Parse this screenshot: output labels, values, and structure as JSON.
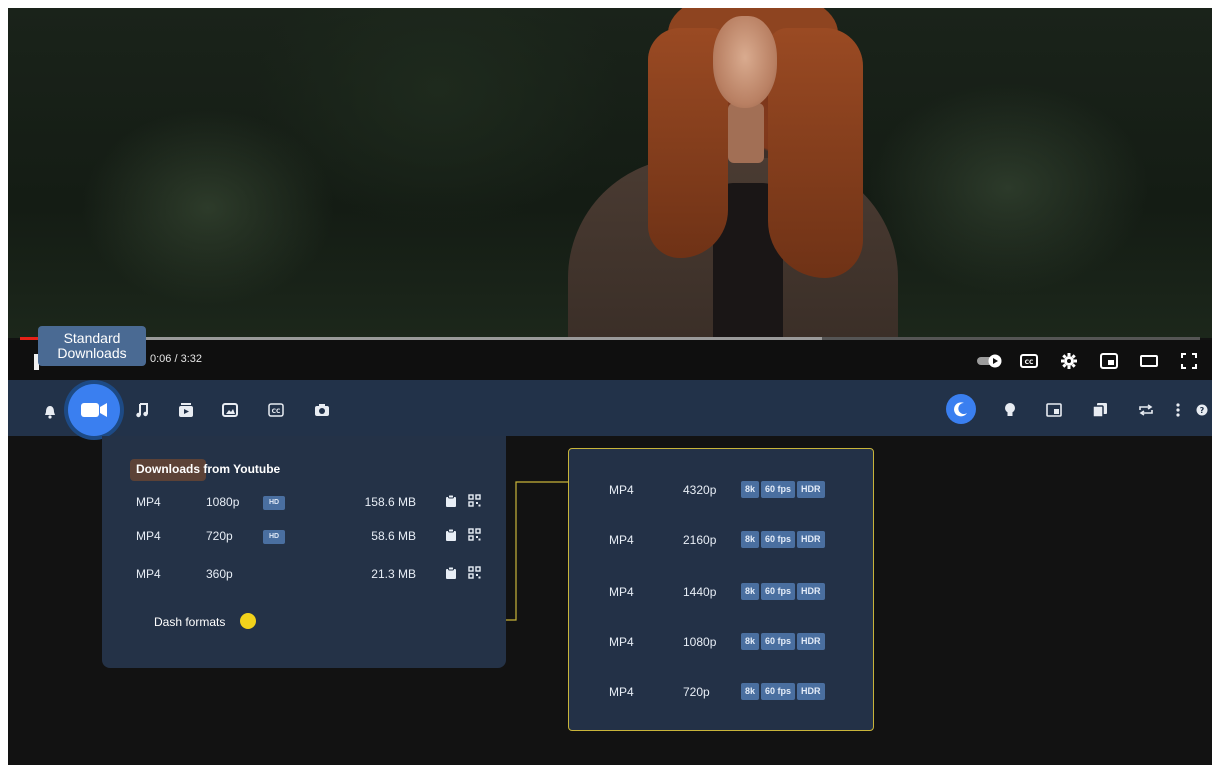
{
  "player": {
    "time": "0:06 / 3:32",
    "progress": 0.03,
    "buffered": 0.68,
    "tooltip": "Standard Downloads",
    "controls": [
      "autoplay-toggle",
      "captions",
      "settings",
      "miniplayer",
      "theater",
      "fullscreen"
    ]
  },
  "toolbar": {
    "left_icons": [
      "bell-icon",
      "video-download-icon",
      "music-icon",
      "playlist-icon",
      "image-icon",
      "subtitles-icon",
      "camera-icon"
    ],
    "right_icons": [
      "moon-icon",
      "lightbulb-icon",
      "pip-icon",
      "copy-icon",
      "repeat-icon",
      "more-icon",
      "help-icon"
    ],
    "accent": "#3a7ff0"
  },
  "downloads_panel": {
    "title": "Downloads from Youtube",
    "rows": [
      {
        "format": "MP4",
        "resolution": "1080p",
        "badge": "HD",
        "size": "158.6 MB"
      },
      {
        "format": "MP4",
        "resolution": "720p",
        "badge": "HD",
        "size": "58.6 MB"
      },
      {
        "format": "MP4",
        "resolution": "360p",
        "badge": "",
        "size": "21.3 MB"
      }
    ],
    "dash_label": "Dash formats"
  },
  "dash_panel": {
    "rows": [
      {
        "format": "MP4",
        "resolution": "4320p",
        "tags": [
          "8k",
          "60 fps",
          "HDR"
        ]
      },
      {
        "format": "MP4",
        "resolution": "2160p",
        "tags": [
          "8k",
          "60 fps",
          "HDR"
        ]
      },
      {
        "format": "MP4",
        "resolution": "1440p",
        "tags": [
          "8k",
          "60 fps",
          "HDR"
        ]
      },
      {
        "format": "MP4",
        "resolution": "1080p",
        "tags": [
          "8k",
          "60 fps",
          "HDR"
        ]
      },
      {
        "format": "MP4",
        "resolution": "720p",
        "tags": [
          "8k",
          "60 fps",
          "HDR"
        ]
      }
    ]
  },
  "colors": {
    "toolbar_bg": "#223249",
    "panel_bg": "#243247",
    "dash_border": "#c8b43a",
    "dash_dot": "#f2d21b"
  }
}
